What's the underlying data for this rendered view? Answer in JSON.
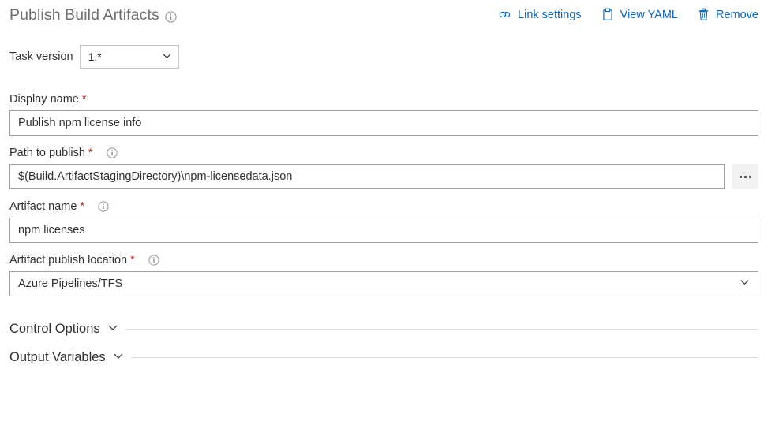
{
  "header": {
    "title": "Publish Build Artifacts",
    "info_icon": "info-icon",
    "toolbar": {
      "link_settings": "Link settings",
      "link_settings_icon": "chain-link-icon",
      "view_yaml": "View YAML",
      "view_yaml_icon": "clipboard-icon",
      "remove": "Remove",
      "remove_icon": "trash-icon"
    },
    "accent_color": "#0f67b1",
    "title_color": "#6e6e6e"
  },
  "task_version": {
    "label": "Task version",
    "value": "1.*",
    "chevron_icon": "chevron-down-icon"
  },
  "fields": {
    "display_name": {
      "label": "Display name",
      "required": "*",
      "value": "Publish npm license info",
      "has_info": false
    },
    "path_to_publish": {
      "label": "Path to publish",
      "required": "*",
      "value": "$(Build.ArtifactStagingDirectory)\\npm-licensedata.json",
      "has_info": true,
      "info_icon": "info-icon",
      "browse_label": "...",
      "browse_icon": "ellipsis-icon"
    },
    "artifact_name": {
      "label": "Artifact name",
      "required": "*",
      "value": "npm licenses",
      "has_info": true,
      "info_icon": "info-icon"
    },
    "artifact_publish_location": {
      "label": "Artifact publish location",
      "required": "*",
      "value": "Azure Pipelines/TFS",
      "has_info": true,
      "info_icon": "info-icon",
      "chevron_icon": "chevron-down-icon"
    }
  },
  "sections": {
    "control_options": {
      "title": "Control Options",
      "chevron_icon": "chevron-down-icon"
    },
    "output_variables": {
      "title": "Output Variables",
      "chevron_icon": "chevron-down-icon"
    }
  },
  "colors": {
    "required_asterisk": "#a4262c",
    "input_border": "#a19f9d",
    "divider": "#e1dfdd",
    "browse_button_bg": "#f3f2f1"
  }
}
